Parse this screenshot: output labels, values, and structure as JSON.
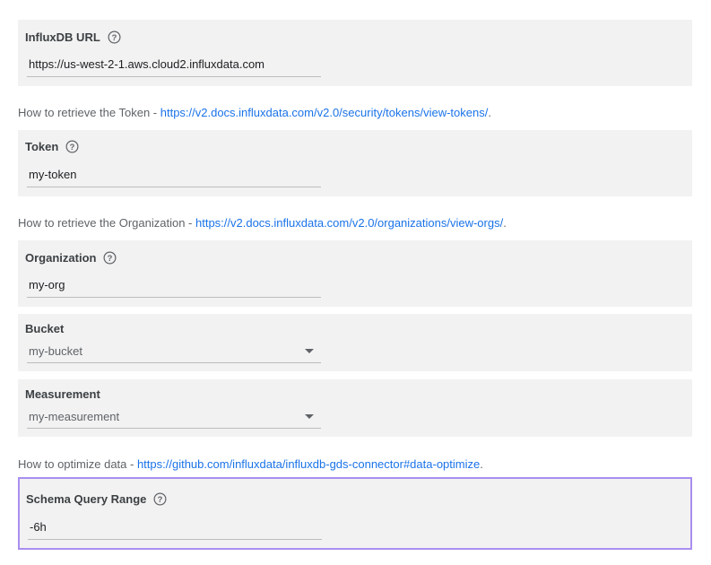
{
  "fields": {
    "url": {
      "label": "InfluxDB URL",
      "value": "https://us-west-2-1.aws.cloud2.influxdata.com"
    },
    "token": {
      "label": "Token",
      "value": "my-token"
    },
    "organization": {
      "label": "Organization",
      "value": "my-org"
    },
    "bucket": {
      "label": "Bucket",
      "selected": "my-bucket"
    },
    "measurement": {
      "label": "Measurement",
      "selected": "my-measurement"
    },
    "schema_range": {
      "label": "Schema Query Range",
      "value": "-6h"
    }
  },
  "help": {
    "token": {
      "prefix": "How to retrieve the Token - ",
      "link": "https://v2.docs.influxdata.com/v2.0/security/tokens/view-tokens/",
      "suffix": "."
    },
    "organization": {
      "prefix": "How to retrieve the Organization - ",
      "link": "https://v2.docs.influxdata.com/v2.0/organizations/view-orgs/",
      "suffix": "."
    },
    "optimize": {
      "prefix": "How to optimize data - ",
      "link": "https://github.com/influxdata/influxdb-gds-connector#data-optimize",
      "suffix": "."
    }
  },
  "icons": {
    "help": "question-circle-icon",
    "dropdown": "triangle-down-icon"
  },
  "colors": {
    "panel_bg": "#f2f2f2",
    "link": "#1a73e8",
    "focus_border": "#a98ef0"
  }
}
